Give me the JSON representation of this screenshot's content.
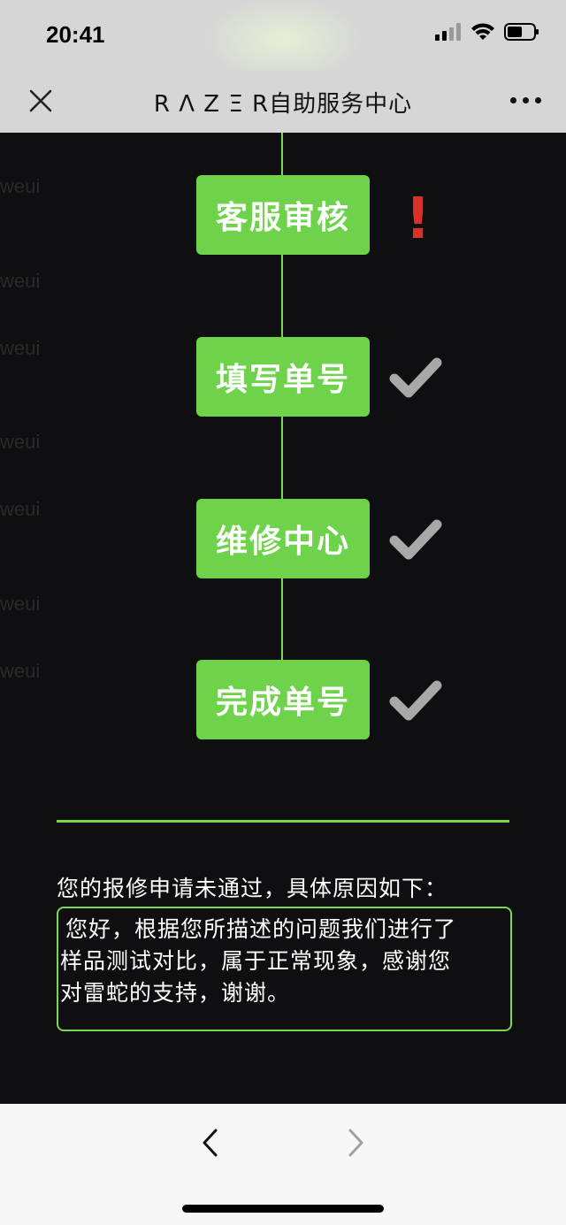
{
  "status_bar": {
    "time": "20:41",
    "icons": [
      "signal-icon",
      "wifi-icon",
      "battery-icon"
    ]
  },
  "nav": {
    "title": "R Λ Z Ξ R自助服务中心",
    "icons": [
      "close-icon",
      "more-icon"
    ]
  },
  "background_text": {
    "items": [
      "weui",
      "weui",
      "weui",
      "weui",
      "weui",
      "weui",
      "weui"
    ]
  },
  "steps": [
    {
      "label": "客服审核",
      "status": "error",
      "mark": "!"
    },
    {
      "label": "填写单号",
      "status": "done",
      "mark": "check-icon"
    },
    {
      "label": "维修中心",
      "status": "done",
      "mark": "check-icon"
    },
    {
      "label": "完成单号",
      "status": "done",
      "mark": "check-icon"
    }
  ],
  "reason": {
    "intro": "您的报修申请未通过，具体原因如下：",
    "lines": [
      "您好，根据您所描述的问题我们进行了",
      "样品测试对比，属于正常现象，感谢您",
      "对雷蛇的支持，谢谢。"
    ]
  },
  "colors": {
    "accent_green": "#6ed34a",
    "error_red": "#d9302c",
    "check_gray": "#a8a8a8",
    "dark_bg": "#0f0e10"
  },
  "bottom_bar": {
    "icons": [
      "back-arrow-icon",
      "forward-arrow-icon"
    ]
  }
}
